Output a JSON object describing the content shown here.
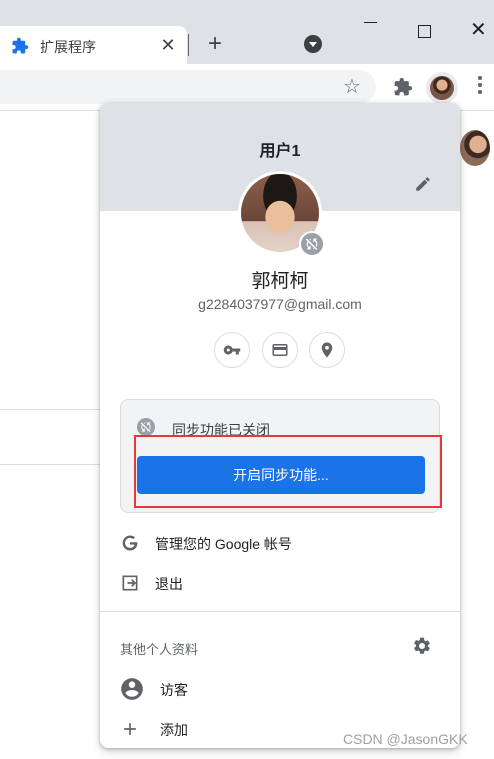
{
  "browser": {
    "tab": {
      "title": "扩展程序",
      "close_glyph": "✕"
    },
    "new_tab_glyph": "+",
    "window": {
      "close_glyph": "✕"
    },
    "toolbar": {
      "star_glyph": "☆"
    }
  },
  "profile_menu": {
    "profile_name": "用户1",
    "full_name": "郭柯柯",
    "email": "g2284037977@gmail.com",
    "quick_actions": [
      {
        "icon": "key-icon"
      },
      {
        "icon": "credit-card-icon"
      },
      {
        "icon": "location-pin-icon"
      }
    ],
    "sync": {
      "status": "同步功能已关闭",
      "button": "开启同步功能..."
    },
    "items": {
      "manage_account": "管理您的 Google 帐号",
      "sign_out": "退出"
    },
    "other_profiles": {
      "heading": "其他个人资料",
      "guest": "访客",
      "add": "添加"
    }
  },
  "colors": {
    "accent": "#1a73e8",
    "highlight_border": "#e53935",
    "header_bg": "#dee1e6"
  },
  "watermark": "CSDN @JasonGKK"
}
